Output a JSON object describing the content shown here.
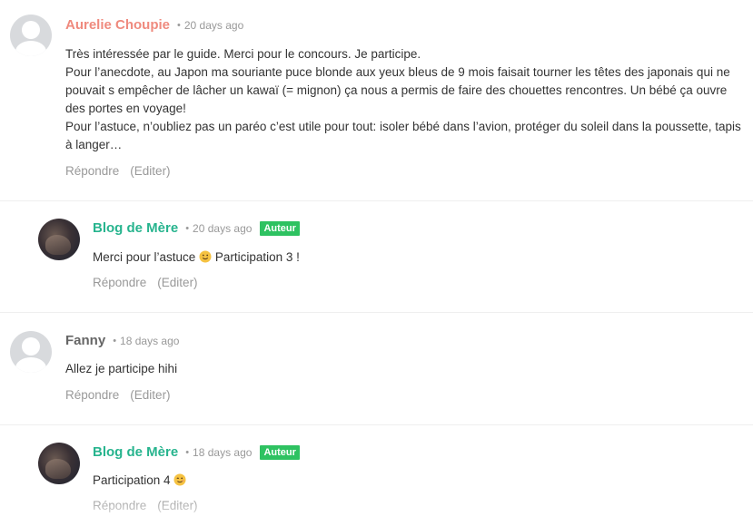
{
  "comments": [
    {
      "author": "Aurelie Choupie",
      "time": "20 days ago",
      "paragraphs": [
        "Très intéressée par le guide. Merci pour le concours. Je participe.",
        "Pour l’anecdote, au Japon ma souriante puce blonde aux yeux bleus de 9 mois faisait tourner les têtes des japonais qui ne pouvait s empêcher de lâcher un kawaï (= mignon) ça nous a permis de faire des chouettes rencontres. Un bébé ça ouvre des portes en voyage!",
        "Pour l’astuce, n’oubliez pas un paréo c’est utile pour tout: isoler bébé dans l’avion, protéger du soleil dans la poussette, tapis à langer…"
      ],
      "reply": "Répondre",
      "edit": "(Editer)"
    },
    {
      "author": "Blog de Mère",
      "time": "20 days ago",
      "badge": "Auteur",
      "text_before": "Merci pour l’astuce",
      "text_after": " Participation 3 !",
      "emoji": "slightly-smiling-face-emoji",
      "reply": "Répondre",
      "edit": "(Editer)"
    },
    {
      "author": "Fanny",
      "time": "18 days ago",
      "text": "Allez je participe hihi",
      "reply": "Répondre",
      "edit": "(Editer)"
    },
    {
      "author": "Blog de Mère",
      "time": "18 days ago",
      "badge": "Auteur",
      "text_before": "Participation 4",
      "emoji": "winking-face-emoji",
      "reply": "Répondre",
      "edit": "(Editer)"
    }
  ],
  "colors": {
    "author_pink": "#ef8a7e",
    "author_green": "#27b48e",
    "author_grey": "#666666",
    "badge_green": "#2ec261",
    "muted": "#999999"
  }
}
